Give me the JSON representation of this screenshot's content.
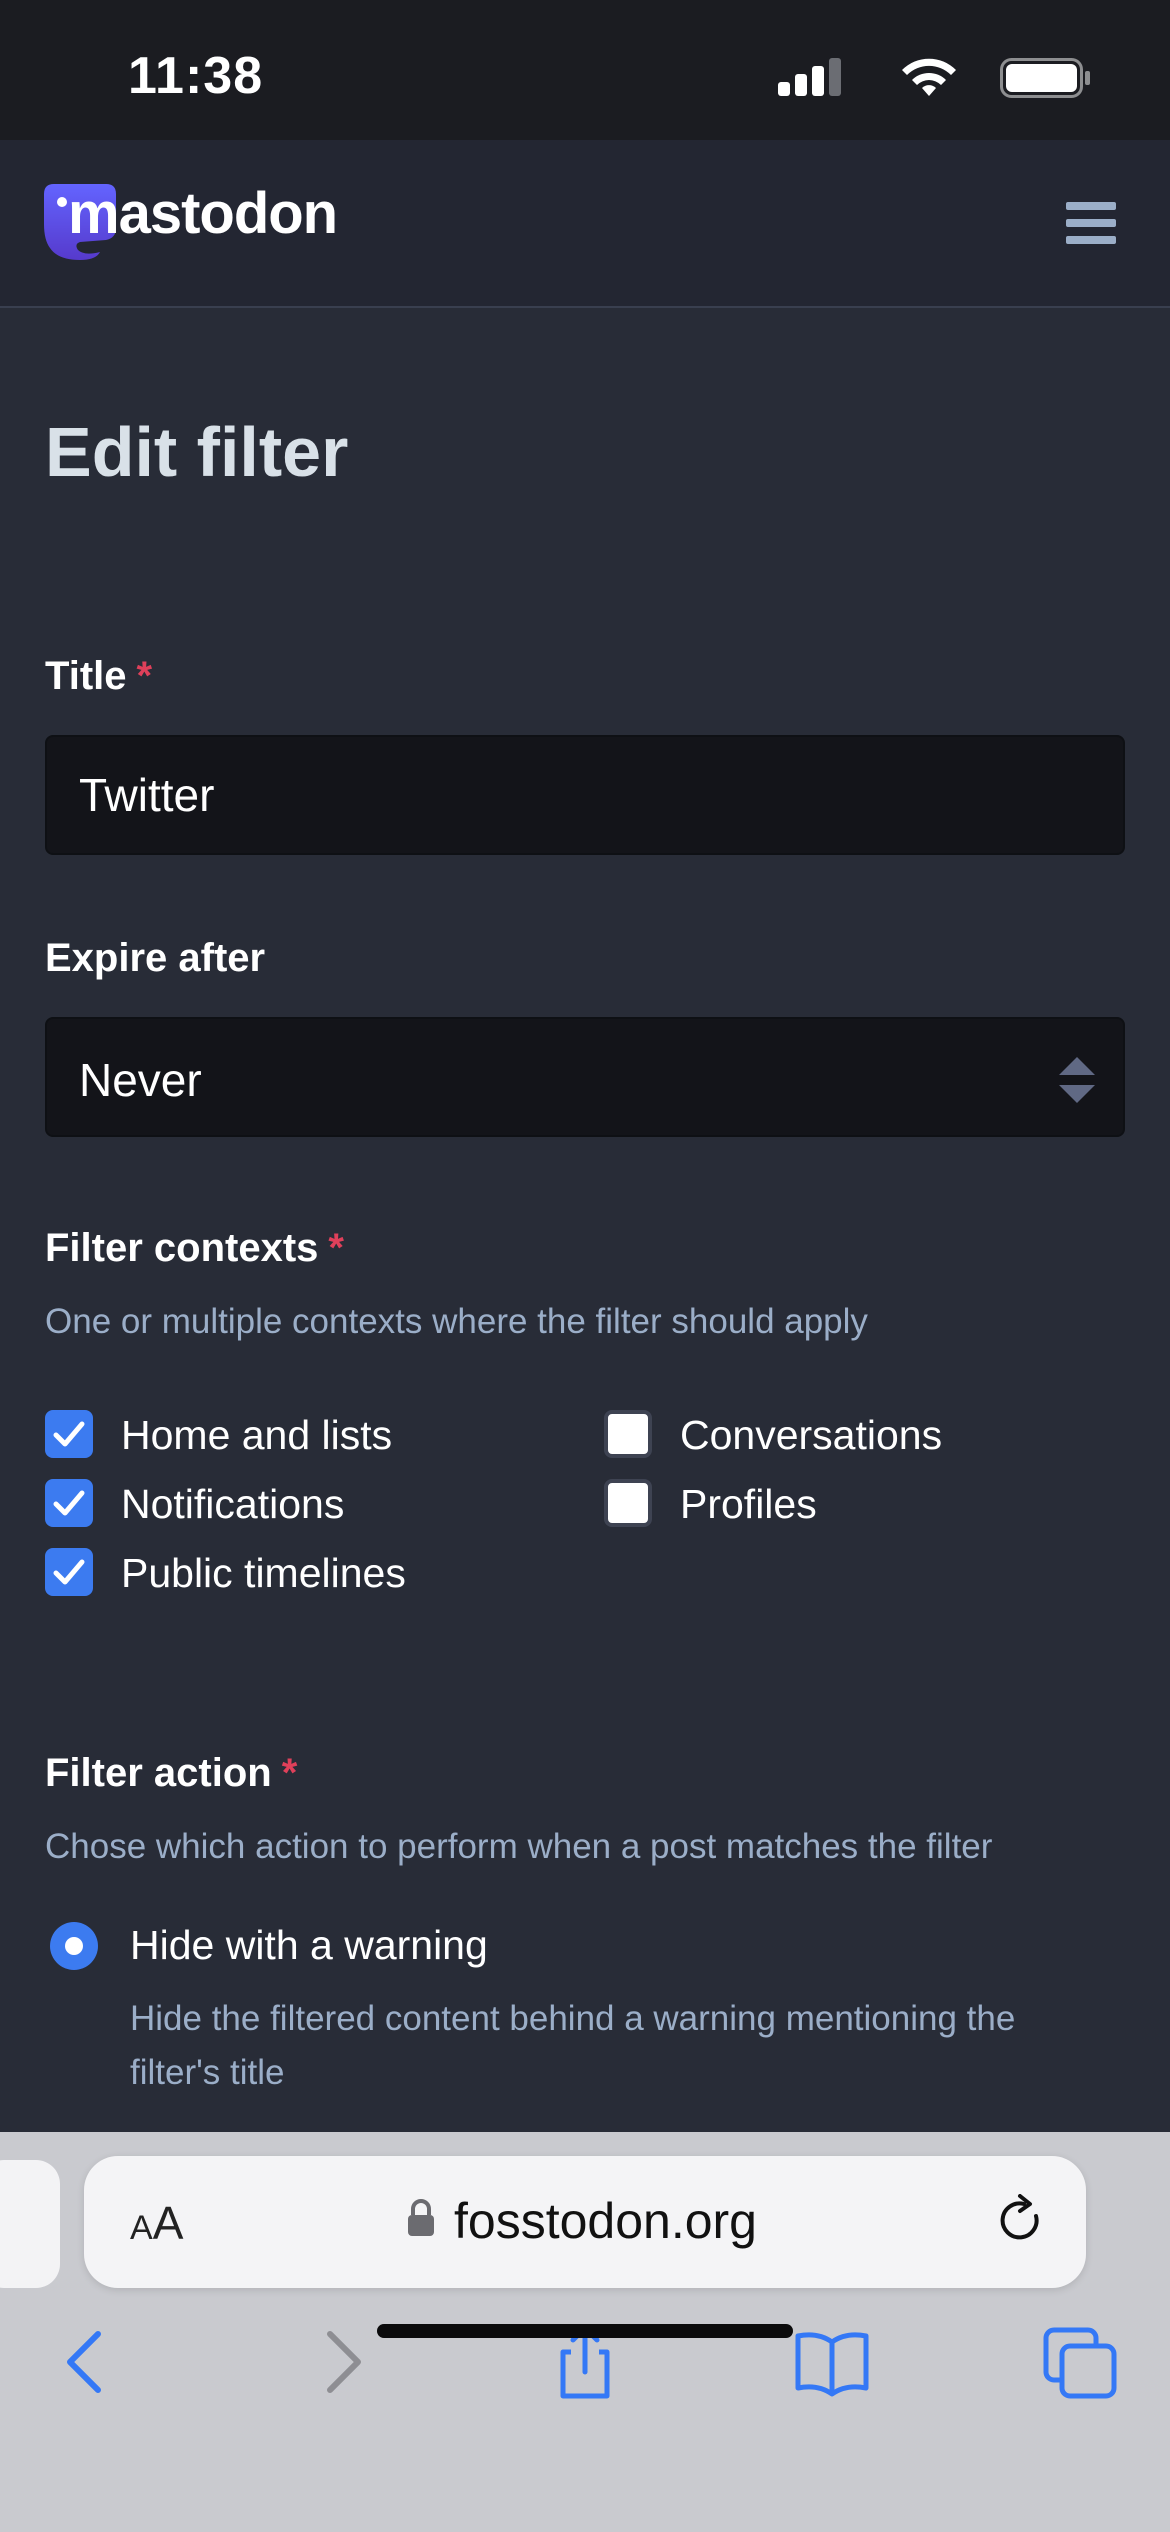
{
  "status_bar": {
    "time": "11:38"
  },
  "header": {
    "logo_text": "mastodon"
  },
  "page": {
    "title": "Edit filter"
  },
  "form": {
    "title_field": {
      "label": "Title",
      "required_mark": "*",
      "value": "Twitter"
    },
    "expire_field": {
      "label": "Expire after",
      "selected": "Never"
    },
    "contexts": {
      "label": "Filter contexts",
      "required_mark": "*",
      "hint": "One or multiple contexts where the filter should apply",
      "options": [
        {
          "label": "Home and lists",
          "checked": true
        },
        {
          "label": "Notifications",
          "checked": true
        },
        {
          "label": "Public timelines",
          "checked": true
        },
        {
          "label": "Conversations",
          "checked": false
        },
        {
          "label": "Profiles",
          "checked": false
        }
      ]
    },
    "action": {
      "label": "Filter action",
      "required_mark": "*",
      "hint": "Chose which action to perform when a post matches the filter",
      "options": [
        {
          "label": "Hide with a warning",
          "hint": "Hide the filtered content behind a warning mentioning the filter's title",
          "selected": true
        }
      ]
    }
  },
  "browser": {
    "text_size_label": "AA",
    "url": "fosstodon.org"
  },
  "colors": {
    "accent": "#3c7bf0",
    "required": "#df405a",
    "background": "#282c37",
    "header": "#232632",
    "hint": "#9baec8"
  }
}
